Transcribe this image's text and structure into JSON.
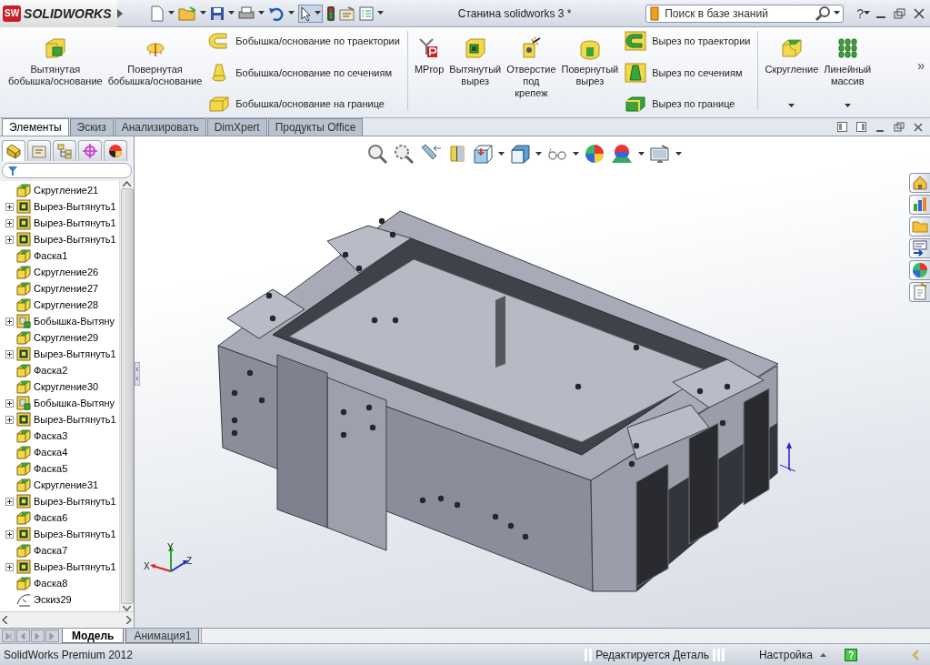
{
  "app": {
    "logo_badge": "SW",
    "logo": "SOLIDWORKS"
  },
  "window": {
    "title": "Станина solidworks 3 *"
  },
  "search": {
    "placeholder": "Поиск в базе знаний"
  },
  "help": "?",
  "ribbon": {
    "items": [
      {
        "kind": "large",
        "label": "Вытянутая\nбобышка/основание"
      },
      {
        "kind": "large",
        "label": "Повернутая\nбобышка/основание"
      },
      {
        "kind": "stack",
        "entries": [
          "Бобышка/основание по траектории",
          "Бобышка/основание по сечениям",
          "Бобышка/основание на границе"
        ]
      },
      {
        "kind": "separator"
      },
      {
        "kind": "large",
        "label": "MProp"
      },
      {
        "kind": "large",
        "label": "Вытянутый\nвырез"
      },
      {
        "kind": "large",
        "label": "Отверстие\nпод\nкрепеж"
      },
      {
        "kind": "large",
        "label": "Повернутый\nвырез"
      },
      {
        "kind": "stack",
        "entries": [
          "Вырез по траектории",
          "Вырез по сечениям",
          "Вырез по границе"
        ]
      },
      {
        "kind": "separator"
      },
      {
        "kind": "dropdown",
        "label": "Скругление"
      },
      {
        "kind": "dropdown",
        "label": "Линейный\nмассив"
      }
    ],
    "more": "»"
  },
  "command_tabs": [
    {
      "label": "Элементы",
      "selected": true
    },
    {
      "label": "Эскиз",
      "selected": false
    },
    {
      "label": "Анализировать",
      "selected": false
    },
    {
      "label": "DimXpert",
      "selected": false
    },
    {
      "label": "Продукты Office",
      "selected": false
    }
  ],
  "tree": {
    "items": [
      {
        "label": "Скругление21",
        "kind": "fillet",
        "expandable": false
      },
      {
        "label": "Вырез-Вытянуть1",
        "kind": "cut",
        "expandable": true
      },
      {
        "label": "Вырез-Вытянуть1",
        "kind": "cut",
        "expandable": true
      },
      {
        "label": "Вырез-Вытянуть1",
        "kind": "cut",
        "expandable": true
      },
      {
        "label": "Фаска1",
        "kind": "fillet",
        "expandable": false
      },
      {
        "label": "Скругление26",
        "kind": "fillet",
        "expandable": false
      },
      {
        "label": "Скругление27",
        "kind": "fillet",
        "expandable": false
      },
      {
        "label": "Скругление28",
        "kind": "fillet",
        "expandable": false
      },
      {
        "label": "Бобышка-Вытяну",
        "kind": "boss",
        "expandable": true
      },
      {
        "label": "Скругление29",
        "kind": "fillet",
        "expandable": false
      },
      {
        "label": "Вырез-Вытянуть1",
        "kind": "cut",
        "expandable": true
      },
      {
        "label": "Фаска2",
        "kind": "fillet",
        "expandable": false
      },
      {
        "label": "Скругление30",
        "kind": "fillet",
        "expandable": false
      },
      {
        "label": "Бобышка-Вытяну",
        "kind": "boss",
        "expandable": true
      },
      {
        "label": "Вырез-Вытянуть1",
        "kind": "cut",
        "expandable": true
      },
      {
        "label": "Фаска3",
        "kind": "fillet",
        "expandable": false
      },
      {
        "label": "Фаска4",
        "kind": "fillet",
        "expandable": false
      },
      {
        "label": "Фаска5",
        "kind": "fillet",
        "expandable": false
      },
      {
        "label": "Скругление31",
        "kind": "fillet",
        "expandable": false
      },
      {
        "label": "Вырез-Вытянуть1",
        "kind": "cut",
        "expandable": true
      },
      {
        "label": "Фаска6",
        "kind": "fillet",
        "expandable": false
      },
      {
        "label": "Вырез-Вытянуть1",
        "kind": "cut",
        "expandable": true
      },
      {
        "label": "Фаска7",
        "kind": "fillet",
        "expandable": false
      },
      {
        "label": "Вырез-Вытянуть1",
        "kind": "cut",
        "expandable": true
      },
      {
        "label": "Фаска8",
        "kind": "fillet",
        "expandable": false
      },
      {
        "label": "Эскиз29",
        "kind": "sketch",
        "expandable": false
      }
    ]
  },
  "triad": {
    "x": "X",
    "y": "Y",
    "z": "Z"
  },
  "bottom_tabs": [
    {
      "label": "Модель",
      "selected": true
    },
    {
      "label": "Анимация1",
      "selected": false
    }
  ],
  "status_bar": {
    "product": "SolidWorks Premium 2012",
    "mode": "Редактируется Деталь",
    "config": "Настройка"
  }
}
